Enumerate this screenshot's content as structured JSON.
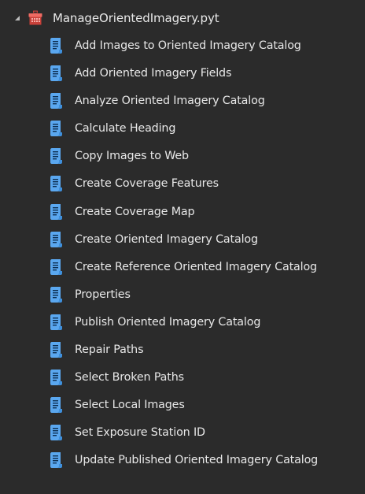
{
  "toolbox": {
    "name": "ManageOrientedImagery.pyt",
    "icon": "toolbox-icon",
    "expanded": true,
    "tools": [
      {
        "label": "Add Images to Oriented Imagery Catalog",
        "icon": "script-tool-icon"
      },
      {
        "label": "Add Oriented Imagery Fields",
        "icon": "script-tool-icon"
      },
      {
        "label": "Analyze Oriented Imagery Catalog",
        "icon": "script-tool-icon"
      },
      {
        "label": "Calculate Heading",
        "icon": "script-tool-icon"
      },
      {
        "label": "Copy Images to Web",
        "icon": "script-tool-icon"
      },
      {
        "label": "Create Coverage Features",
        "icon": "script-tool-icon"
      },
      {
        "label": "Create Coverage Map",
        "icon": "script-tool-icon"
      },
      {
        "label": "Create Oriented Imagery Catalog",
        "icon": "script-tool-icon"
      },
      {
        "label": "Create Reference Oriented Imagery Catalog",
        "icon": "script-tool-icon"
      },
      {
        "label": "Properties",
        "icon": "script-tool-icon"
      },
      {
        "label": "Publish Oriented Imagery Catalog",
        "icon": "script-tool-icon"
      },
      {
        "label": "Repair Paths",
        "icon": "script-tool-icon"
      },
      {
        "label": "Select Broken Paths",
        "icon": "script-tool-icon"
      },
      {
        "label": "Select Local Images",
        "icon": "script-tool-icon"
      },
      {
        "label": "Set Exposure Station ID",
        "icon": "script-tool-icon"
      },
      {
        "label": "Update Published Oriented Imagery Catalog",
        "icon": "script-tool-icon"
      }
    ]
  },
  "colors": {
    "background": "#2b2b2b",
    "text": "#e8e8e8",
    "expander": "#bdbdbd",
    "toolbox_red": "#c9413a",
    "toolbox_light": "#ef6b63",
    "script_icon": "#5aa7ef"
  }
}
